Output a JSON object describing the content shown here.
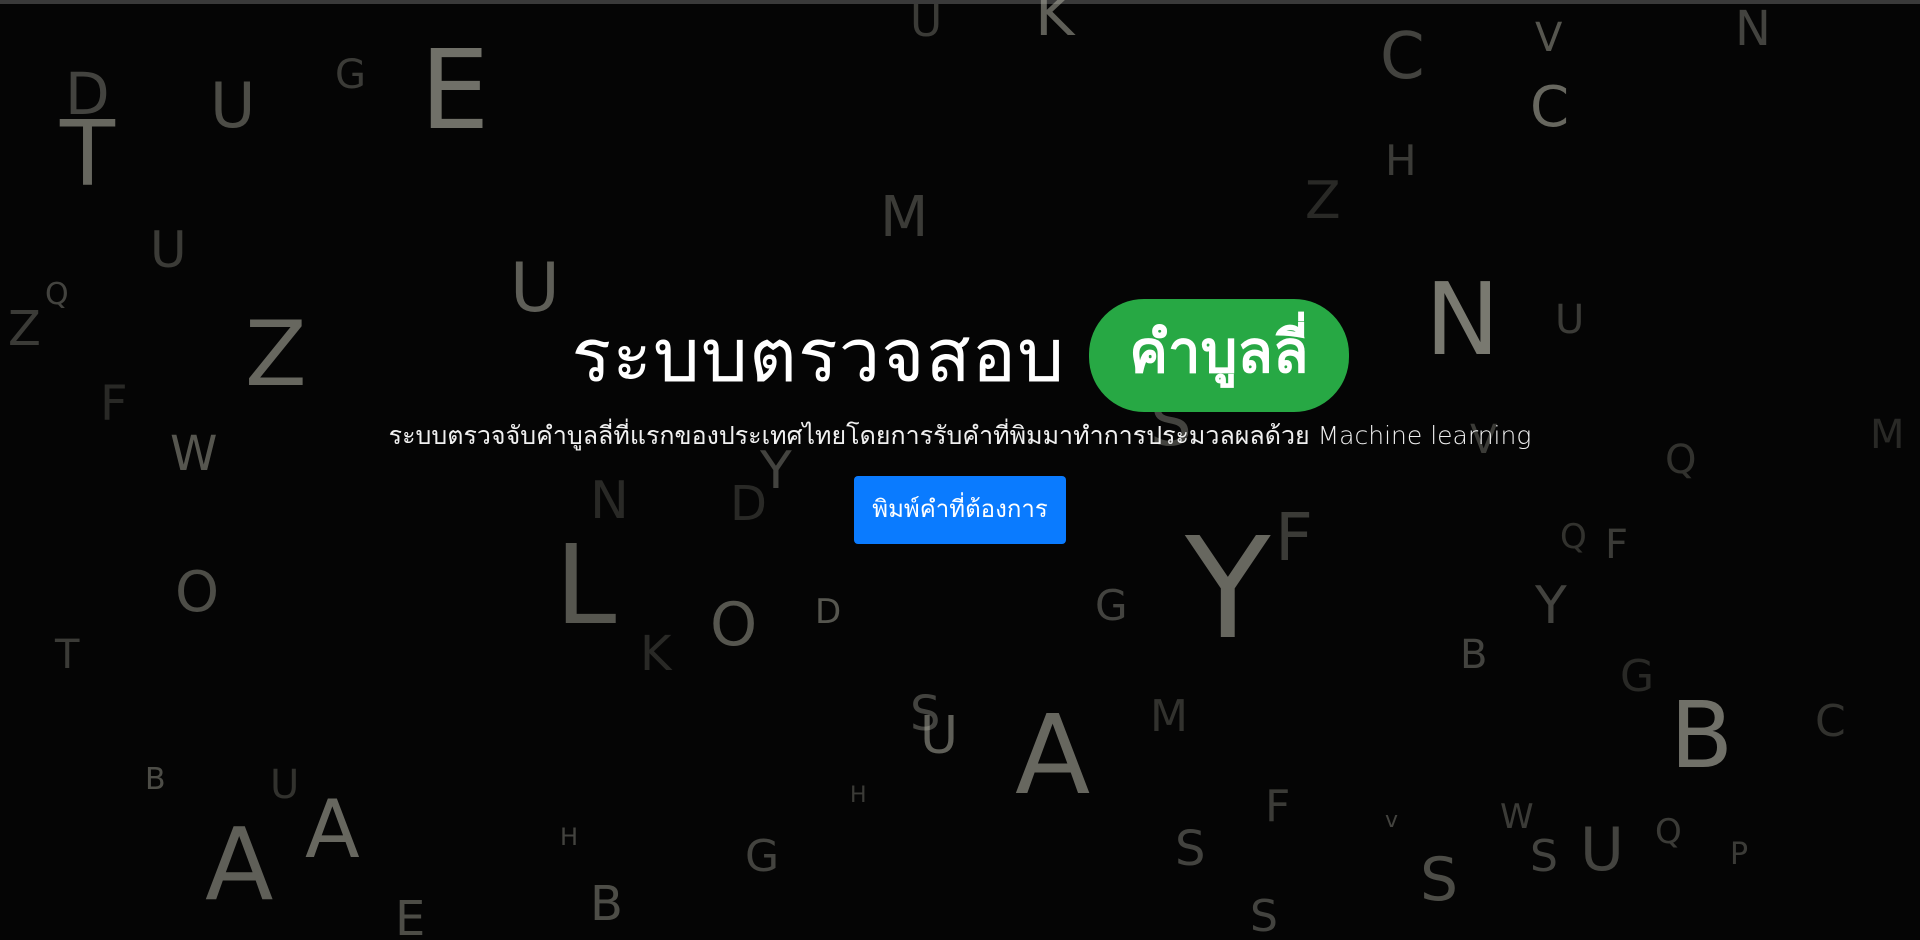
{
  "hero": {
    "title": "ระบบตรวจสอบ",
    "highlight": "คำบูลลี่",
    "subtitle": "ระบบตรวจจับคำบูลลี่ที่แรกของประเทศไทยโดยการรับคำที่พิมมาทำการประมวลผลด้วย Machine learning",
    "cta_label": "พิมพ์คำที่ต้องการ"
  },
  "colors": {
    "background": "#050505",
    "pill": "#27a844",
    "button": "#0a7bff"
  }
}
